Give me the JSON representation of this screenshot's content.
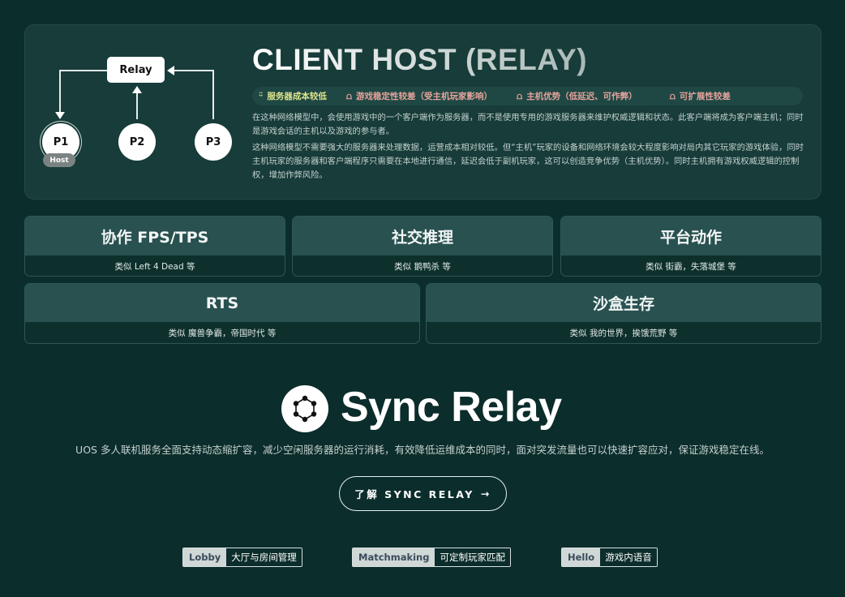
{
  "diagram": {
    "relay_label": "Relay",
    "nodes": [
      "P1",
      "P2",
      "P3"
    ],
    "host_tag": "Host"
  },
  "hero": {
    "title": "CLIENT HOST (RELAY)",
    "badges": [
      {
        "icon": "smile-icon",
        "text": "服务器成本较低",
        "tone": "good"
      },
      {
        "icon": "frown-icon",
        "text": "游戏稳定性较差（受主机玩家影响）",
        "tone": "bad"
      },
      {
        "icon": "frown-icon",
        "text": "主机优势（低延迟、可作弊）",
        "tone": "bad"
      },
      {
        "icon": "frown-icon",
        "text": "可扩展性较差",
        "tone": "bad"
      }
    ],
    "paragraphs": [
      "在这种网络模型中，会使用游戏中的一个客户端作为服务器，而不是使用专用的游戏服务器来维护权威逻辑和状态。此客户端将成为客户端主机；同时是游戏会话的主机以及游戏的参与者。",
      "这种网络模型不需要强大的服务器来处理数据，运营成本相对较低。但“主机”玩家的设备和网络环境会较大程度影响对局内其它玩家的游戏体验，同时主机玩家的服务器和客户端程序只需要在本地进行通信，延迟会低于副机玩家，这可以创造竞争优势（主机优势）。同时主机拥有游戏权威逻辑的控制权，增加作弊风险。"
    ]
  },
  "genres": [
    {
      "title": "协作 FPS/TPS",
      "sub": "类似 Left 4 Dead 等"
    },
    {
      "title": "社交推理",
      "sub": "类似 鹅鸭杀 等"
    },
    {
      "title": "平台动作",
      "sub": "类似 街霸，失落城堡 等"
    },
    {
      "title": "RTS",
      "sub": "类似 魔兽争霸，帝国时代 等"
    },
    {
      "title": "沙盒生存",
      "sub": "类似 我的世界，挨饿荒野 等"
    }
  ],
  "sync_relay": {
    "title": "Sync Relay",
    "description": "UOS 多人联机服务全面支持动态缩扩容，减少空闲服务器的运行消耗，有效降低运维成本的同时，面对突发流量也可以快速扩容应对，保证游戏稳定在线。",
    "button_label": "了解 SYNC RELAY",
    "button_arrow": "→"
  },
  "tags": [
    {
      "key": "Lobby",
      "value": "大厅与房间管理"
    },
    {
      "key": "Matchmaking",
      "value": "可定制玩家匹配"
    },
    {
      "key": "Hello",
      "value": "游戏内语音"
    }
  ]
}
